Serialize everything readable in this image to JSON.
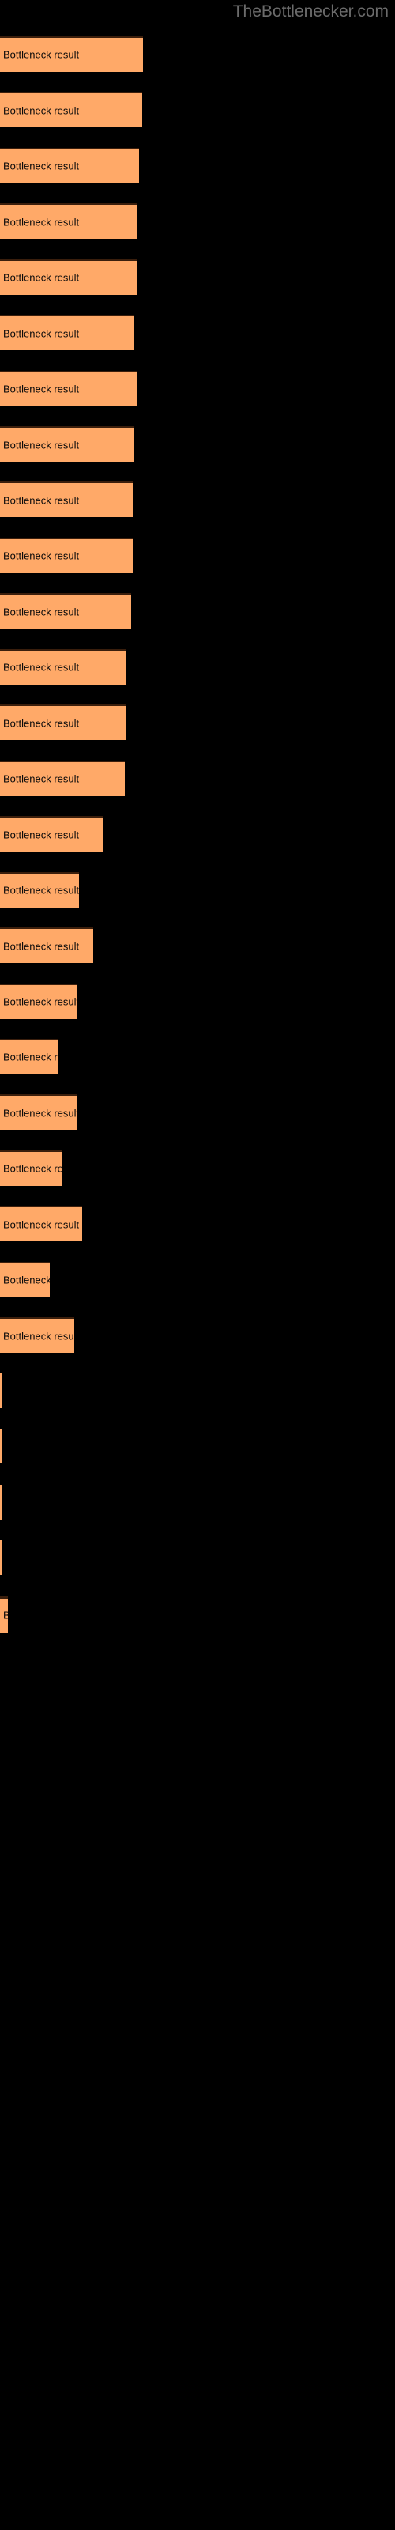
{
  "page": {
    "background_color": "#000000",
    "watermark": "TheBottlenecker.com",
    "watermark_color": "#6b6b6b"
  },
  "chart_data": {
    "type": "bar",
    "orientation": "horizontal",
    "title": "",
    "subtitle": "",
    "xlabel": "",
    "ylabel": "",
    "grid": false,
    "legend": "none",
    "bar_color": "#ffa968",
    "bar_edge_color": "#3a1e0c",
    "label_color": "#0a0a0a",
    "xlim": [
      0,
      100
    ],
    "bar_label_text": "Bottleneck result",
    "categories": [
      "bar-1",
      "bar-2",
      "bar-3",
      "bar-4",
      "bar-5",
      "bar-6",
      "bar-7",
      "bar-8",
      "bar-9",
      "bar-10",
      "bar-11",
      "bar-12",
      "bar-13",
      "bar-14",
      "bar-15",
      "bar-16",
      "bar-17",
      "bar-18",
      "bar-19",
      "bar-20",
      "bar-21",
      "bar-22",
      "bar-23",
      "bar-24",
      "bar-25",
      "bar-26",
      "bar-27",
      "bar-28",
      "bar-29"
    ],
    "values": [
      88,
      87,
      86,
      85,
      85,
      84,
      84,
      83,
      83,
      82,
      81,
      80,
      79,
      78,
      64,
      49,
      58,
      48,
      36,
      48,
      38,
      51,
      31,
      46,
      1,
      0.4,
      0.4,
      0.4,
      11
    ],
    "bars": [
      {
        "label": "Bottleneck result",
        "value": 88,
        "y": 28,
        "width": 181
      },
      {
        "label": "Bottleneck result",
        "value": 87,
        "y": 71,
        "width": 180
      },
      {
        "label": "Bottleneck result",
        "value": 86,
        "y": 114,
        "width": 176
      },
      {
        "label": "Bottleneck result",
        "value": 85,
        "y": 157,
        "width": 173
      },
      {
        "label": "Bottleneck result",
        "value": 85,
        "y": 200,
        "width": 173
      },
      {
        "label": "Bottleneck result",
        "value": 84,
        "y": 243,
        "width": 170
      },
      {
        "label": "Bottleneck result",
        "value": 84,
        "y": 286,
        "width": 173
      },
      {
        "label": "Bottleneck result",
        "value": 83,
        "y": 329,
        "width": 170
      },
      {
        "label": "Bottleneck result",
        "value": 83,
        "y": 372,
        "width": 168
      },
      {
        "label": "Bottleneck result",
        "value": 82,
        "y": 415,
        "width": 168
      },
      {
        "label": "Bottleneck result",
        "value": 81,
        "y": 458,
        "width": 166
      },
      {
        "label": "Bottleneck result",
        "value": 80,
        "y": 501,
        "width": 160
      },
      {
        "label": "Bottleneck result",
        "value": 79,
        "y": 544,
        "width": 160
      },
      {
        "label": "Bottleneck result",
        "value": 78,
        "y": 587,
        "width": 158
      },
      {
        "label": "Bottleneck result",
        "value": 64,
        "y": 630,
        "width": 131
      },
      {
        "label": "Bottleneck result",
        "value": 49,
        "y": 673,
        "width": 100
      },
      {
        "label": "Bottleneck result",
        "value": 58,
        "y": 716,
        "width": 118
      },
      {
        "label": "Bottleneck result",
        "value": 48,
        "y": 759,
        "width": 98
      },
      {
        "label": "Bottleneck result",
        "value": 36,
        "y": 802,
        "width": 73
      },
      {
        "label": "Bottleneck result",
        "value": 48,
        "y": 845,
        "width": 98
      },
      {
        "label": "Bottleneck result",
        "value": 38,
        "y": 888,
        "width": 78
      },
      {
        "label": "Bottleneck result",
        "value": 51,
        "y": 931,
        "width": 104
      },
      {
        "label": "Bottleneck result",
        "value": 31,
        "y": 974,
        "width": 63
      },
      {
        "label": "Bottleneck result",
        "value": 46,
        "y": 1017,
        "width": 94
      },
      {
        "label": "Bottleneck result",
        "value": 1,
        "y": 1060,
        "width": 2
      },
      {
        "label": "Bottleneck result",
        "value": 0.4,
        "y": 1103,
        "width": 1
      },
      {
        "label": "Bottleneck result",
        "value": 0.4,
        "y": 1146,
        "width": 1
      },
      {
        "label": "Bottleneck result",
        "value": 0.4,
        "y": 1189,
        "width": 1
      },
      {
        "label": "Bottleneck result",
        "value": 11,
        "y": 1232,
        "width": 10
      }
    ]
  }
}
